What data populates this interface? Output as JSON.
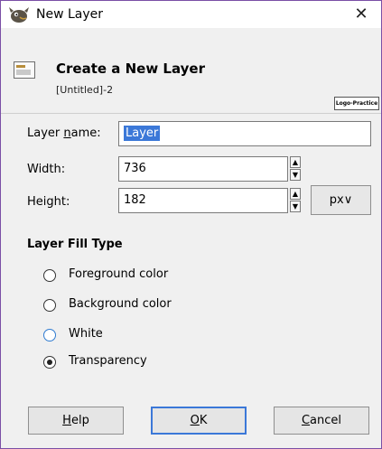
{
  "window": {
    "title": "New Layer"
  },
  "header": {
    "title": "Create a New Layer",
    "subtitle": "[Untitled]-2",
    "logo_text": "Logo-Practice"
  },
  "form": {
    "layer_name": {
      "label_pre": "Layer ",
      "label_mn": "n",
      "label_post": "ame:",
      "value": "Layer"
    },
    "width": {
      "label": "Width:",
      "value": "736"
    },
    "height": {
      "label": "Height:",
      "value": "182"
    },
    "unit": {
      "selected": "px",
      "arrow": "∨"
    }
  },
  "fill_type": {
    "title": "Layer Fill Type",
    "options": [
      {
        "label": "Foreground color",
        "selected": false
      },
      {
        "label": "Background color",
        "selected": false
      },
      {
        "label": "White",
        "selected": false
      },
      {
        "label": "Transparency",
        "selected": true
      }
    ]
  },
  "buttons": {
    "help": {
      "mn": "H",
      "rest": "elp"
    },
    "ok": {
      "mn": "O",
      "rest": "K"
    },
    "cancel": {
      "mn": "C",
      "rest": "ancel"
    }
  },
  "colors": {
    "accent": "#3b78d8",
    "window_border": "#7a4fa6"
  }
}
